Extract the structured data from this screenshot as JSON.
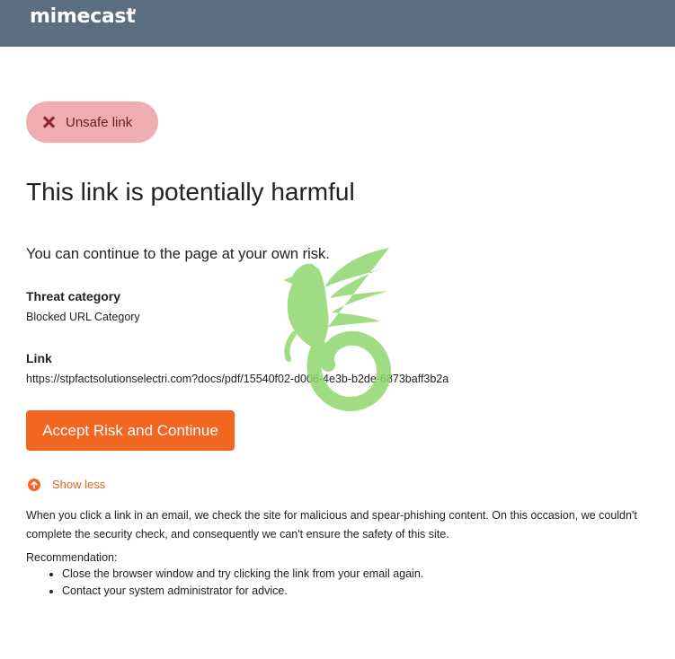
{
  "header": {
    "logo_text": "mimecast"
  },
  "status_badge": {
    "label": "Unsafe link",
    "icon": "close-icon"
  },
  "title": "This link is potentially harmful",
  "lead": "You can continue to the page at your own risk.",
  "threat": {
    "label": "Threat category",
    "value": "Blocked URL Category"
  },
  "link": {
    "label": "Link",
    "value": "https://stpfactsolutionselectri.com?docs/pdf/15540f02-d006-4e3b-b2de-6873baff3b2a"
  },
  "accept_button": "Accept Risk and Continue",
  "toggle": {
    "label": "Show less",
    "icon": "arrow-up-circle-icon"
  },
  "details": "When you click a link in an email, we check the site for malicious and spear-phishing content. On this occasion, we couldn't complete the security check, and consequently we can't ensure the safety of this site.",
  "recommendation": {
    "label": "Recommendation:",
    "items": [
      "Close the browser window and try clicking the link from your email again.",
      "Contact your system administrator for advice."
    ]
  },
  "colors": {
    "header": "#5b6d80",
    "accent": "#f26622",
    "badge_bg": "#efadb0",
    "badge_text": "#6e1a24",
    "watermark": "#8fd66e"
  }
}
